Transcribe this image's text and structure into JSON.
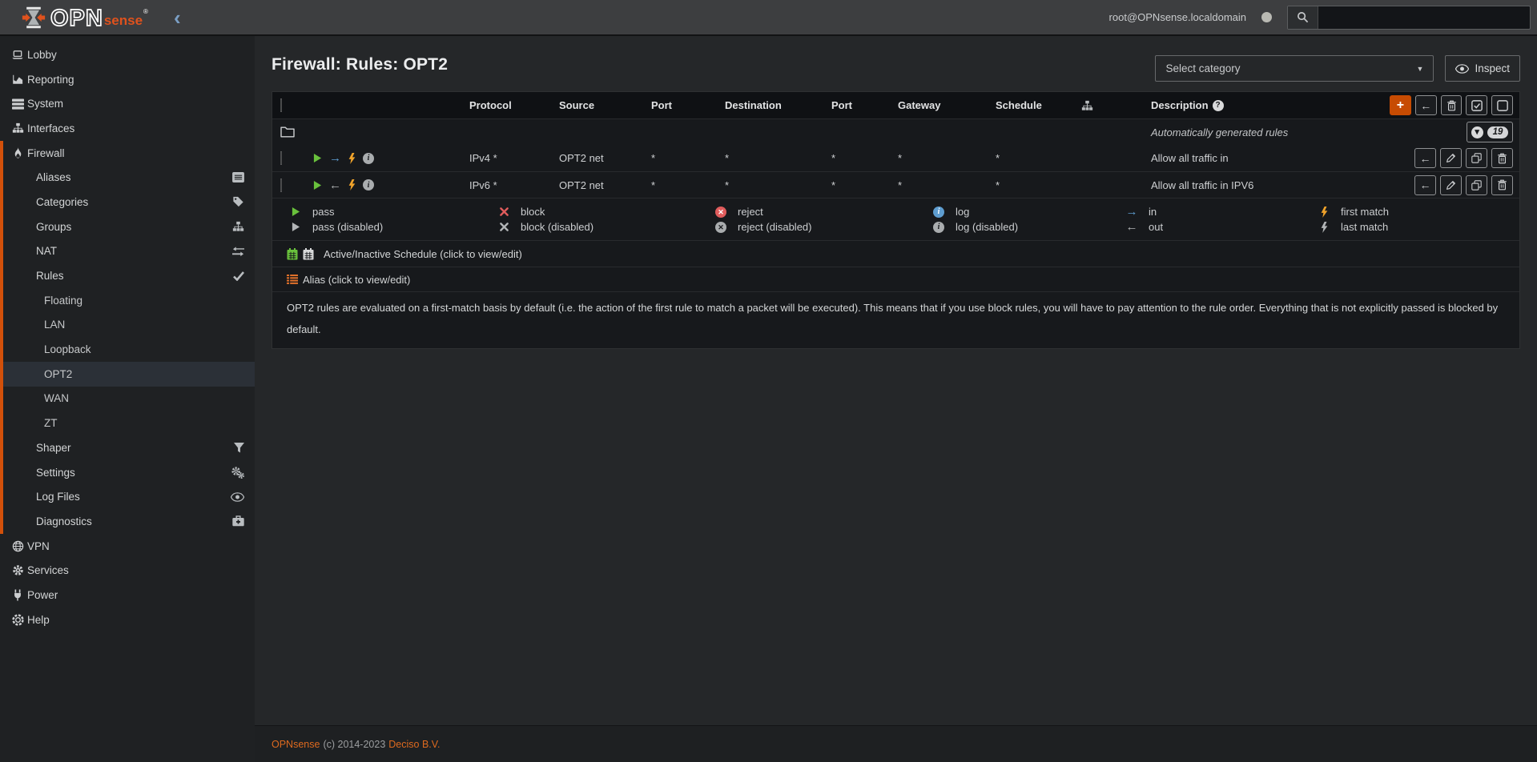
{
  "topbar": {
    "brand_opn": "OPN",
    "brand_sense": "sense",
    "brand_reg": "®",
    "collapse_icon": "‹",
    "user": "root@OPNsense.localdomain",
    "search_placeholder": ""
  },
  "sidebar": {
    "items": [
      {
        "label": "Lobby",
        "icon": "laptop",
        "level": 0
      },
      {
        "label": "Reporting",
        "icon": "chart",
        "level": 0
      },
      {
        "label": "System",
        "icon": "server",
        "level": 0
      },
      {
        "label": "Interfaces",
        "icon": "sitemap",
        "level": 0
      },
      {
        "label": "Firewall",
        "icon": "fire",
        "level": 0,
        "section": true
      },
      {
        "label": "Aliases",
        "level": 1,
        "section": true,
        "right_icon": "table"
      },
      {
        "label": "Categories",
        "level": 1,
        "section": true,
        "right_icon": "tags"
      },
      {
        "label": "Groups",
        "level": 1,
        "section": true,
        "right_icon": "sitemap"
      },
      {
        "label": "NAT",
        "level": 1,
        "section": true,
        "right_icon": "exchange"
      },
      {
        "label": "Rules",
        "level": 1,
        "section": true,
        "right_icon": "check"
      },
      {
        "label": "Floating",
        "level": 2,
        "section": true
      },
      {
        "label": "LAN",
        "level": 2,
        "section": true
      },
      {
        "label": "Loopback",
        "level": 2,
        "section": true
      },
      {
        "label": "OPT2",
        "level": 2,
        "section": true,
        "selected": true
      },
      {
        "label": "WAN",
        "level": 2,
        "section": true
      },
      {
        "label": "ZT",
        "level": 2,
        "section": true
      },
      {
        "label": "Shaper",
        "level": 1,
        "section": true,
        "right_icon": "filter"
      },
      {
        "label": "Settings",
        "level": 1,
        "section": true,
        "right_icon": "gears"
      },
      {
        "label": "Log Files",
        "level": 1,
        "section": true,
        "right_icon": "eye"
      },
      {
        "label": "Diagnostics",
        "level": 1,
        "section": true,
        "right_icon": "medkit"
      },
      {
        "label": "VPN",
        "icon": "globe",
        "level": 0
      },
      {
        "label": "Services",
        "icon": "gear",
        "level": 0
      },
      {
        "label": "Power",
        "icon": "plug",
        "level": 0
      },
      {
        "label": "Help",
        "icon": "help",
        "level": 0
      }
    ]
  },
  "main": {
    "title": "Firewall: Rules: OPT2",
    "category_select": "Select category",
    "inspect_label": "Inspect",
    "table": {
      "headers": [
        "Protocol",
        "Source",
        "Port",
        "Destination",
        "Port",
        "Gateway",
        "Schedule",
        "Description"
      ],
      "auto_rules": {
        "label": "Automatically generated rules",
        "count": "19"
      },
      "rules": [
        {
          "protocol": "IPv4 *",
          "source": "OPT2 net",
          "port": "*",
          "destination": "*",
          "port2": "*",
          "gateway": "*",
          "schedule": "*",
          "description": "Allow all traffic in",
          "action": "pass",
          "direction": "in",
          "match": "first",
          "log": true
        },
        {
          "protocol": "IPv6 *",
          "source": "OPT2 net",
          "port": "*",
          "destination": "*",
          "port2": "*",
          "gateway": "*",
          "schedule": "*",
          "description": "Allow all traffic in IPV6",
          "action": "pass",
          "direction": "out",
          "match": "first",
          "log": true
        }
      ],
      "legend": [
        {
          "icon": "pass",
          "line1": "pass",
          "line2": "pass (disabled)"
        },
        {
          "icon": "block",
          "line1": "block",
          "line2": "block (disabled)"
        },
        {
          "icon": "reject",
          "line1": "reject",
          "line2": "reject (disabled)"
        },
        {
          "icon": "log",
          "line1": "log",
          "line2": "log (disabled)"
        },
        {
          "icon": "direction",
          "line1": "in",
          "line2": "out"
        },
        {
          "icon": "match",
          "line1": "first match",
          "line2": "last match"
        }
      ],
      "schedule_row": "Active/Inactive Schedule (click to view/edit)",
      "alias_row": "Alias (click to view/edit)",
      "note": "OPT2 rules are evaluated on a first-match basis by default (i.e. the action of the first rule to match a packet will be executed). This means that if you use block rules, you will have to pay attention to the rule order. Everything that is not explicitly passed is blocked by default."
    }
  },
  "footer": {
    "brand": "OPNsense",
    "middle": "(c) 2014-2023",
    "company": "Deciso B.V."
  },
  "icons": {
    "collapse": "‹",
    "caret_down": "▼",
    "arrow_in": "→",
    "arrow_out": "←",
    "arrow_left": "←",
    "plus": "+",
    "info": "i",
    "question": "?",
    "chevron_down": "▾"
  },
  "colors": {
    "accent_orange": "#d2500a",
    "pass_green": "#69c13c",
    "block_red": "#e05c5c",
    "log_blue": "#5e9dd0",
    "match_orange": "#f0a32b",
    "disabled_gray": "#b2b5b7"
  }
}
